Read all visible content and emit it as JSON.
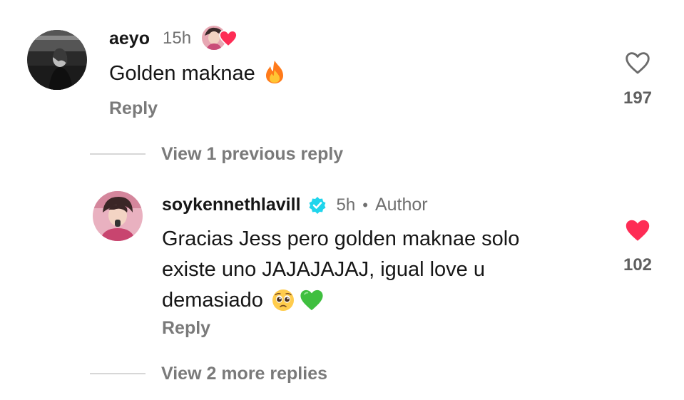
{
  "comment": {
    "username": "aeyo",
    "time": "15h",
    "text": "Golden maknae",
    "text_emoji": "fire",
    "reply_label": "Reply",
    "like_count": "197",
    "liked": false
  },
  "thread": {
    "view_previous_label": "View 1 previous reply",
    "view_more_label": "View 2 more replies"
  },
  "reply": {
    "username": "soykennethlavill",
    "verified": true,
    "time": "5h",
    "separator": "•",
    "author_label": "Author",
    "text_line1": "Gracias Jess pero golden maknae solo",
    "text_line2": "existe uno JAJAJAJAJ, igual love u",
    "text_line3": "demasiado",
    "text_emojis": [
      "pleading-face",
      "green-heart"
    ],
    "reply_label": "Reply",
    "like_count": "102",
    "liked": true
  },
  "colors": {
    "like_red": "#fe2c55",
    "verified_blue": "#20d5ec",
    "muted_text": "#7a7a7a"
  }
}
